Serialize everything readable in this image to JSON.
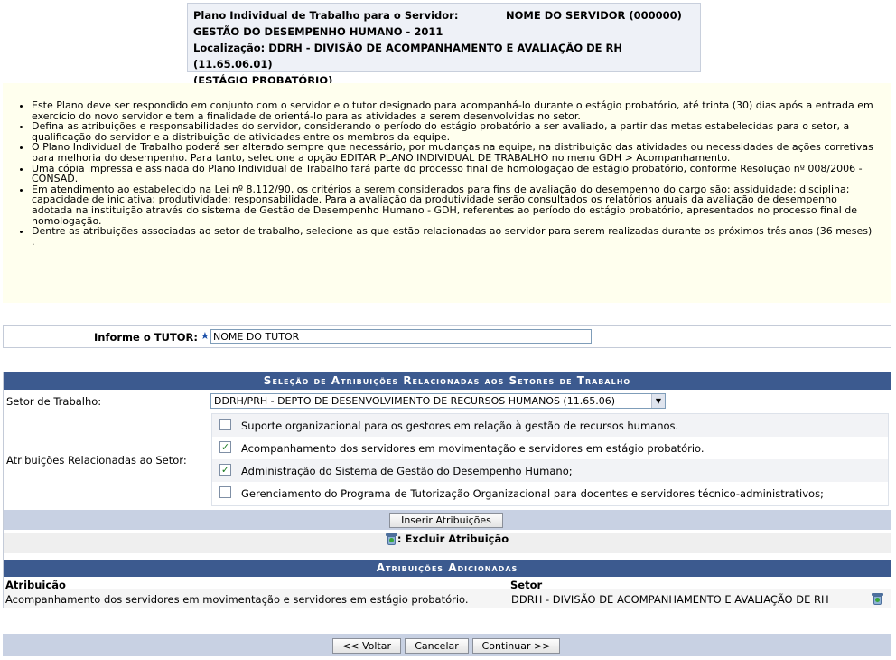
{
  "header": {
    "line1_label": "Plano Individual de Trabalho para o Servidor:",
    "line1_value": "NOME DO SERVIDOR (000000)",
    "line2": "GESTÃO DO DESEMPENHO HUMANO - 2011",
    "line3": "Localização: DDRH - DIVISÃO DE ACOMPANHAMENTO E AVALIAÇÃO DE RH (11.65.06.01)",
    "line4": "(ESTÁGIO PROBATÓRIO)"
  },
  "instructions": [
    "Este Plano deve ser respondido em conjunto com o servidor e o tutor designado para acompanhá-lo durante o estágio probatório, até trinta (30) dias após a entrada em exercício do novo servidor e tem a finalidade de orientá-lo para as atividades a serem desenvolvidas no setor.",
    "Defina as atribuições e responsabilidades do servidor, considerando o período do estágio probatório a ser avaliado, a partir das metas estabelecidas para o setor, a qualificação do servidor e a distribuição de atividades entre os membros da equipe.",
    "O Plano Individual de Trabalho poderá ser alterado sempre que necessário, por mudanças na equipe, na distribuição das atividades ou necessidades de ações corretivas para melhoria do desempenho. Para tanto, selecione a opção EDITAR PLANO INDIVIDUAL DE TRABALHO no menu GDH > Acompanhamento.",
    "Uma cópia impressa e assinada do Plano Individual de Trabalho fará parte do processo final de homologação de estágio probatório, conforme Resolução nº 008/2006 - CONSAD.",
    "Em atendimento ao estabelecido na Lei nº 8.112/90, os critérios a serem considerados para fins de avaliação do desempenho do cargo são: assiduidade; disciplina; capacidade de iniciativa; produtividade; responsabilidade. Para a avaliação da produtividade serão consultados os relatórios anuais da avaliação de desempenho adotada na instituição através do sistema de Gestão de Desempenho Humano - GDH, referentes ao período do estágio probatório, apresentados no processo final de homologação.",
    "Dentre as atribuições associadas ao setor de trabalho, selecione as que estão relacionadas ao servidor para serem realizadas durante os próximos três anos (36 meses) ."
  ],
  "tutor": {
    "label": "Informe o TUTOR:",
    "required_mark": "★",
    "value": "NOME DO TUTOR"
  },
  "selection": {
    "caption": "Seleção de Atribuições Relacionadas aos Setores de Trabalho",
    "sector_label": "Setor de Trabalho:",
    "sector_value": "DDRH/PRH - DEPTO DE DESENVOLVIMENTO DE RECURSOS HUMANOS (11.65.06)",
    "attributions_label": "Atribuições Relacionadas ao Setor:",
    "options": [
      {
        "label": "Suporte organizacional para os gestores em relação à gestão de recursos humanos.",
        "checked": false
      },
      {
        "label": "Acompanhamento dos servidores em movimentação e servidores em estágio probatório.",
        "checked": true
      },
      {
        "label": "Administração do Sistema de Gestão do Desempenho Humano;",
        "checked": true
      },
      {
        "label": "Gerenciamento do Programa de Tutorização Organizacional para docentes e servidores técnico-administrativos;",
        "checked": false
      }
    ],
    "insert_button": "Inserir Atribuições",
    "remove_legend": ": Excluir Atribuição"
  },
  "added": {
    "caption": "Atribuições Adicionadas",
    "col_attr": "Atribuição",
    "col_sector": "Setor",
    "rows": [
      {
        "attribution": "Acompanhamento dos servidores em movimentação e servidores em estágio probatório.",
        "sector": "DDRH - DIVISÃO DE ACOMPANHAMENTO E AVALIAÇÃO DE RH"
      }
    ]
  },
  "footer": {
    "back": "<< Voltar",
    "cancel": "Cancelar",
    "continue": "Continuar >>"
  },
  "colors": {
    "caption_bg": "#3c5a8f",
    "bar_bg": "#c8d1e3",
    "info_bg": "#ffffee"
  }
}
